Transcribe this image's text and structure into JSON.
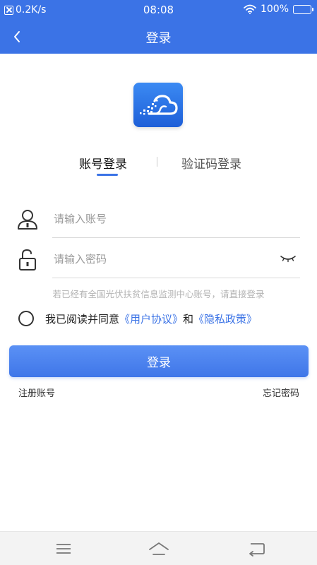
{
  "status_bar": {
    "speed": "0.2K/s",
    "time": "08:08",
    "battery": "100%"
  },
  "header": {
    "title": "登录"
  },
  "tabs": {
    "account_login": "账号登录",
    "sms_login": "验证码登录"
  },
  "form": {
    "account_placeholder": "请输入账号",
    "password_placeholder": "请输入密码",
    "hint": "若已经有全国光伏扶贫信息监测中心账号，请直接登录"
  },
  "agreement": {
    "prefix": "我已阅读并同意",
    "user_agreement": "《用户协议》",
    "and": "和",
    "privacy_policy": "《隐私政策》"
  },
  "actions": {
    "login": "登录",
    "register": "注册账号",
    "forgot_password": "忘记密码"
  },
  "colors": {
    "primary": "#3b73e6",
    "hint": "#b3b3b3"
  },
  "icons": {
    "back": "chevron-left-icon",
    "account": "user-icon",
    "password": "unlock-icon",
    "visibility": "eye-closed-icon",
    "logo": "cloud-logo-icon"
  }
}
